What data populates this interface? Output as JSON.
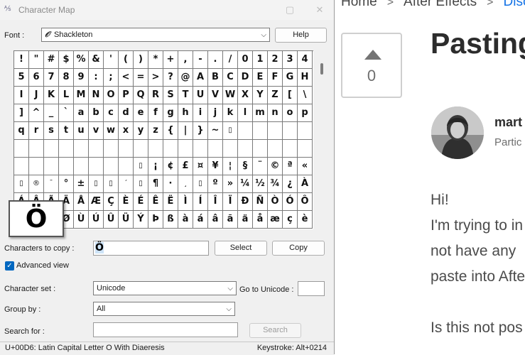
{
  "window": {
    "title": "Character Map",
    "font_label": "Font :",
    "font_value": "Shackleton",
    "font_icon_glyph": "𝒪",
    "help_label": "Help",
    "characters_label": "Characters to copy :",
    "characters_value": "Ö",
    "select_label": "Select",
    "copy_label": "Copy",
    "advanced_label": "Advanced view",
    "advanced_checked": true,
    "charset_label": "Character set :",
    "charset_value": "Unicode",
    "goto_label": "Go to Unicode :",
    "goto_value": "",
    "groupby_label": "Group by :",
    "groupby_value": "All",
    "search_label": "Search for :",
    "search_value": "",
    "search_button": "Search",
    "status_left": "U+00D6: Latin Capital Letter O With Diaeresis",
    "status_right": "Keystroke: Alt+0214",
    "zoom_char": "Ö"
  },
  "grid_rows": [
    [
      "!",
      "\"",
      "#",
      "$",
      "%",
      "&",
      "'",
      "(",
      ")",
      "*",
      "+",
      ",",
      "-",
      ".",
      "/",
      "0",
      "1",
      "2",
      "3",
      "4"
    ],
    [
      "5",
      "6",
      "7",
      "8",
      "9",
      ":",
      ";",
      "<",
      "=",
      ">",
      "?",
      "@",
      "A",
      "B",
      "C",
      "D",
      "E",
      "F",
      "G",
      "H"
    ],
    [
      "I",
      "J",
      "K",
      "L",
      "M",
      "N",
      "O",
      "P",
      "Q",
      "R",
      "S",
      "T",
      "U",
      "V",
      "W",
      "X",
      "Y",
      "Z",
      "[",
      "\\"
    ],
    [
      "]",
      "^",
      "_",
      "`",
      "a",
      "b",
      "c",
      "d",
      "e",
      "f",
      "g",
      "h",
      "i",
      "j",
      "k",
      "l",
      "m",
      "n",
      "o",
      "p"
    ],
    [
      "q",
      "r",
      "s",
      "t",
      "u",
      "v",
      "w",
      "x",
      "y",
      "z",
      "{",
      "|",
      "}",
      "~",
      "▯",
      "",
      "",
      "",
      "",
      ""
    ],
    [
      "",
      "",
      "",
      "",
      "",
      "",
      "",
      "",
      "",
      "",
      "",
      "",
      "",
      "",
      "",
      "",
      "",
      "",
      "",
      ""
    ],
    [
      "",
      "",
      "",
      "",
      "",
      "",
      "",
      "",
      "▯",
      "¡",
      "¢",
      "£",
      "¤",
      "¥",
      "¦",
      "§",
      "¨",
      "©",
      "ª",
      "«",
      "¬"
    ],
    [
      "▯",
      "®",
      "¯",
      "°",
      "±",
      "▯",
      "▯",
      "´",
      "▯",
      "¶",
      "·",
      "¸",
      "▯",
      "º",
      "»",
      "¼",
      "½",
      "¾",
      "¿",
      "À"
    ],
    [
      "Á",
      "Â",
      "Ã",
      "Ä",
      "Å",
      "Æ",
      "Ç",
      "È",
      "É",
      "Ê",
      "Ë",
      "Ì",
      "Í",
      "Î",
      "Ï",
      "Ð",
      "Ñ",
      "Ò",
      "Ó",
      "Ô"
    ],
    [
      "Õ",
      "Ö",
      "×",
      "Ø",
      "Ù",
      "Ú",
      "Û",
      "Ü",
      "Ý",
      "Þ",
      "ß",
      "à",
      "á",
      "â",
      "ã",
      "ä",
      "å",
      "æ",
      "ç",
      "è"
    ]
  ],
  "small_glyphs": [
    "®",
    "¯",
    "´",
    "¸",
    "▯"
  ],
  "web": {
    "crumbs": [
      "Home",
      "After Effects",
      "Disc"
    ],
    "crumb_sep": ">",
    "votes": "0",
    "title": "Pasting",
    "author": "mart",
    "role": "Partic",
    "lines": [
      "Hi!",
      "I'm trying to in",
      "not have any",
      "paste into Afte",
      "",
      "Is this not pos"
    ]
  }
}
